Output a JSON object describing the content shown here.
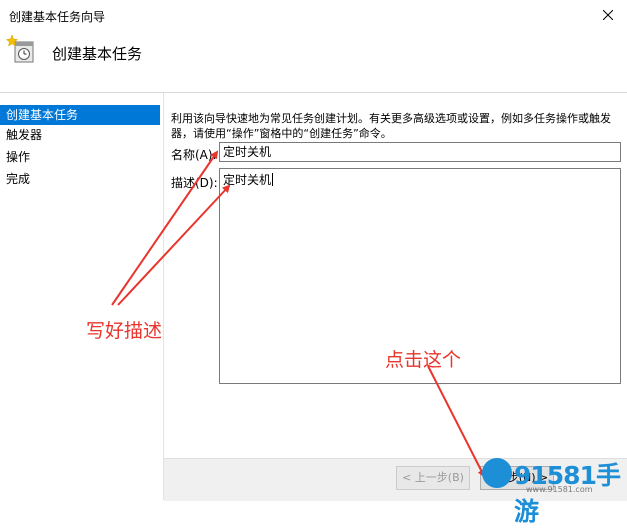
{
  "window": {
    "title": "创建基本任务向导"
  },
  "header": {
    "title": "创建基本任务"
  },
  "sidebar": {
    "items": [
      {
        "label": "创建基本任务"
      },
      {
        "label": "触发器"
      },
      {
        "label": "操作"
      },
      {
        "label": "完成"
      }
    ]
  },
  "main": {
    "description": "利用该向导快速地为常见任务创建计划。有关更多高级选项或设置，例如多任务操作或触发器，请使用“操作”窗格中的“创建任务”命令。",
    "name_label": "名称(A):",
    "name_value": "定时关机",
    "desc_label": "描述(D):",
    "desc_value": "定时关机"
  },
  "footer": {
    "back_label": "< 上一步(B)",
    "next_label": "下一步(N) >"
  },
  "annotations": {
    "write_desc": "写好描述",
    "click_this": "点击这个",
    "color": "#e8352d"
  },
  "watermark": {
    "logo": "91581手游",
    "url": "www.91581.com"
  }
}
